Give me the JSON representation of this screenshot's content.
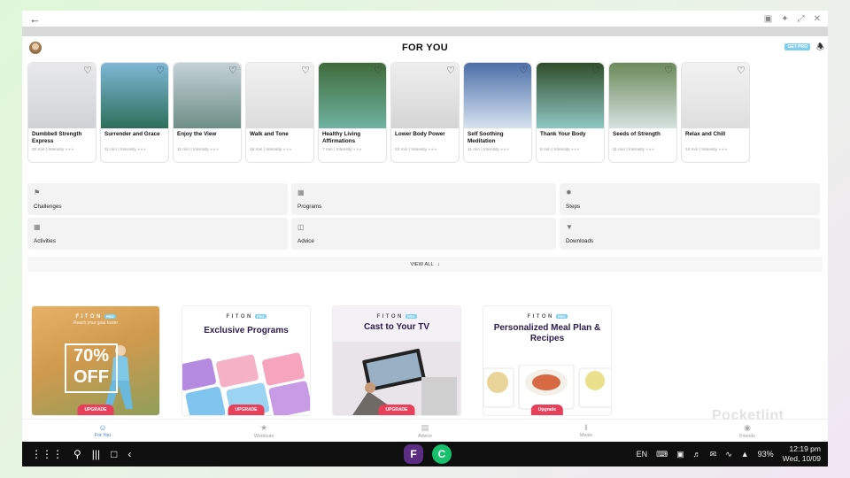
{
  "window": {
    "back_icon": "arrow-left-icon",
    "controls": [
      "screenshot-icon",
      "pin-icon",
      "restore-icon",
      "close-icon"
    ]
  },
  "header": {
    "title": "FOR YOU",
    "get_pro": "GET PRO"
  },
  "cards": [
    {
      "title": "Dumbbell Strength Express",
      "duration": "20 min",
      "intensity": "Intensity",
      "color_top": "#e9e9ea",
      "color_bottom": "#cfd2d6"
    },
    {
      "title": "Surrender and Grace",
      "duration": "11 min",
      "intensity": "Intensity",
      "color_top": "#7fb7d6",
      "color_bottom": "#2e6f5a"
    },
    {
      "title": "Enjoy the View",
      "duration": "11 min",
      "intensity": "Intensity",
      "color_top": "#c4d2d8",
      "color_bottom": "#6e8e86"
    },
    {
      "title": "Walk and Tone",
      "duration": "16 min",
      "intensity": "Intensity",
      "color_top": "#f1f1f1",
      "color_bottom": "#dcdcdc"
    },
    {
      "title": "Healthy Living Affirmations",
      "duration": "7 min",
      "intensity": "Intensity",
      "color_top": "#3f6b3a",
      "color_bottom": "#6fb3a1"
    },
    {
      "title": "Lower Body Power",
      "duration": "22 min",
      "intensity": "Intensity",
      "color_top": "#eeeeee",
      "color_bottom": "#d5d5d5"
    },
    {
      "title": "Self Soothing Meditation",
      "duration": "11 min",
      "intensity": "Intensity",
      "color_top": "#4c6fa8",
      "color_bottom": "#d7e3f0"
    },
    {
      "title": "Thank Your Body",
      "duration": "8 min",
      "intensity": "Intensity",
      "color_top": "#2f4d2a",
      "color_bottom": "#8fc7c4"
    },
    {
      "title": "Seeds of Strength",
      "duration": "11 min",
      "intensity": "Intensity",
      "color_top": "#6c8a5a",
      "color_bottom": "#d6e2e0"
    },
    {
      "title": "Relax and Chill",
      "duration": "10 min",
      "intensity": "Intensity",
      "color_top": "#f2f2f2",
      "color_bottom": "#dedede"
    }
  ],
  "tiles": {
    "challenges": "Challenges",
    "programs": "Programs",
    "steps": "Steps",
    "activities": "Activities",
    "advice": "Advice",
    "downloads": "Downloads"
  },
  "view_all": "VIEW ALL",
  "promos": [
    {
      "logo": "FITON",
      "pro": "PRO",
      "subtitle": "Reach your goal faster",
      "badge_top": "70%",
      "badge_bottom": "OFF",
      "button": "UPGRADE"
    },
    {
      "logo": "FITON",
      "pro": "PRO",
      "title": "Exclusive Programs",
      "button": "UPGRADE"
    },
    {
      "logo": "FITON",
      "pro": "PRO",
      "title": "Cast to Your TV",
      "button": "UPGRADE"
    },
    {
      "logo": "FITON",
      "pro": "PRO",
      "title": "Personalized Meal Plan & Recipes",
      "button": "Upgrade"
    }
  ],
  "bottom_nav": [
    {
      "label": "For You",
      "icon": "user-circle-icon",
      "active": true
    },
    {
      "label": "Workouts",
      "icon": "figure-icon",
      "active": false
    },
    {
      "label": "Advice",
      "icon": "document-icon",
      "active": false
    },
    {
      "label": "Meals",
      "icon": "utensils-icon",
      "active": false
    },
    {
      "label": "Friends",
      "icon": "friends-icon",
      "active": false
    }
  ],
  "watermark": "Pocketlint",
  "taskbar": {
    "lang": "EN",
    "battery": "93%",
    "time": "12:19 pm",
    "date": "Wed, 10/09"
  }
}
